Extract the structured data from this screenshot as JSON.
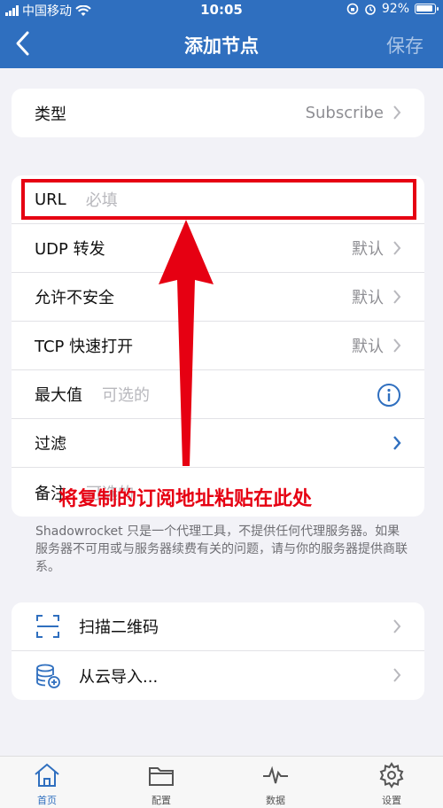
{
  "status_bar": {
    "carrier": "中国移动",
    "time": "10:05",
    "battery": "92%"
  },
  "nav": {
    "title": "添加节点",
    "save_label": "保存",
    "back_icon": "chevron-left-icon"
  },
  "type_row": {
    "label": "类型",
    "value": "Subscribe"
  },
  "form_rows": [
    {
      "label": "URL",
      "placeholder": "必填"
    },
    {
      "label": "UDP 转发",
      "value": "默认"
    },
    {
      "label": "允许不安全",
      "value": "默认"
    },
    {
      "label": "TCP 快速打开",
      "value": "默认"
    },
    {
      "label": "最大值",
      "placeholder": "可选的"
    },
    {
      "label": "过滤"
    },
    {
      "label": "备注",
      "placeholder": "可选的"
    }
  ],
  "note": "Shadowrocket 只是一个代理工具，不提供任何代理服务器。如果服务器不可用或与服务器续费有关的问题，请与你的服务器提供商联系。",
  "actions": [
    {
      "label": "扫描二维码",
      "icon": "qr-scan-icon"
    },
    {
      "label": "从云导入...",
      "icon": "cloud-database-icon"
    }
  ],
  "annotation": {
    "text": "将复制的订阅地址粘贴在此处",
    "color": "#e60012"
  },
  "tabs": [
    {
      "label": "首页",
      "icon": "home-icon",
      "active": true
    },
    {
      "label": "配置",
      "icon": "folder-icon",
      "active": false
    },
    {
      "label": "数据",
      "icon": "activity-icon",
      "active": false
    },
    {
      "label": "设置",
      "icon": "gear-icon",
      "active": false
    }
  ],
  "colors": {
    "accent": "#2f6fbf",
    "annotation": "#e60012"
  }
}
